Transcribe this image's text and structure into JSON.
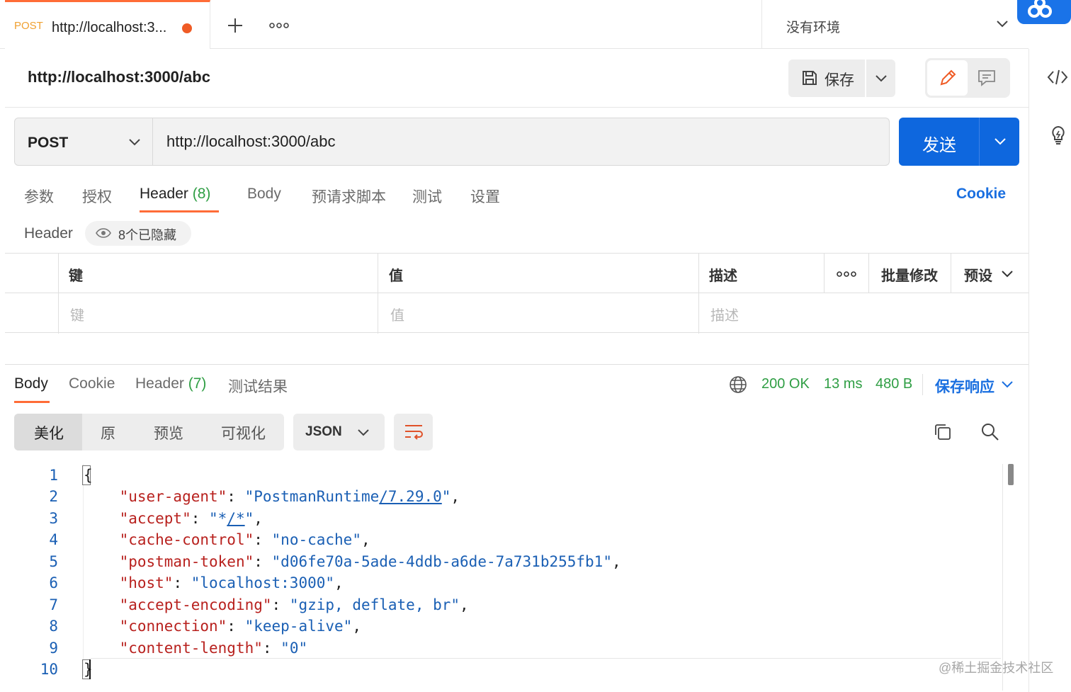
{
  "tabbar": {
    "active_tab": {
      "method": "POST",
      "title": "http://localhost:3..."
    },
    "new_tab_icon": "plus-icon",
    "more_icon": "more-horizontal-icon",
    "environment": "没有环境"
  },
  "request": {
    "title": "http://localhost:3000/abc",
    "save_label": "保存",
    "method": "POST",
    "url": "http://localhost:3000/abc",
    "send_label": "发送"
  },
  "request_tabs": {
    "params": "参数",
    "auth": "授权",
    "headers": "Header",
    "headers_count": "(8)",
    "body": "Body",
    "prerequest": "预请求脚本",
    "tests": "测试",
    "settings": "设置",
    "cookie": "Cookie"
  },
  "headers_section": {
    "title": "Header",
    "hidden_label": "8个已隐藏",
    "table": {
      "col_key": "键",
      "col_value": "值",
      "col_desc": "描述",
      "bulk_edit": "批量修改",
      "presets": "预设",
      "placeholder_key": "键",
      "placeholder_value": "值",
      "placeholder_desc": "描述"
    }
  },
  "response": {
    "tabs": {
      "body": "Body",
      "cookie": "Cookie",
      "headers": "Header",
      "headers_count": "(7)",
      "test_results": "测试结果"
    },
    "status": "200 OK",
    "time": "13 ms",
    "size": "480 B",
    "save_response": "保存响应",
    "views": {
      "pretty": "美化",
      "raw": "原",
      "preview": "预览",
      "visualize": "可视化"
    },
    "format": "JSON"
  },
  "code": {
    "line_numbers": [
      "1",
      "2",
      "3",
      "4",
      "5",
      "6",
      "7",
      "8",
      "9",
      "10"
    ],
    "open_brace": "{",
    "close_brace": "}",
    "lines": [
      {
        "key": "\"user-agent\"",
        "pre": "\"PostmanRuntime",
        "link": "/7.29.0",
        "post": "\"",
        "comma": ","
      },
      {
        "key": "\"accept\"",
        "pre": "\"*",
        "link": "/*",
        "post": "\"",
        "comma": ","
      },
      {
        "key": "\"cache-control\"",
        "pre": "\"no-cache\"",
        "link": "",
        "post": "",
        "comma": ","
      },
      {
        "key": "\"postman-token\"",
        "pre": "\"d06fe70a-5ade-4ddb-a6de-7a731b255fb1\"",
        "link": "",
        "post": "",
        "comma": ","
      },
      {
        "key": "\"host\"",
        "pre": "\"localhost:3000\"",
        "link": "",
        "post": "",
        "comma": ","
      },
      {
        "key": "\"accept-encoding\"",
        "pre": "\"gzip, deflate, br\"",
        "link": "",
        "post": "",
        "comma": ","
      },
      {
        "key": "\"connection\"",
        "pre": "\"keep-alive\"",
        "link": "",
        "post": "",
        "comma": ","
      },
      {
        "key": "\"content-length\"",
        "pre": "\"0\"",
        "link": "",
        "post": "",
        "comma": ""
      }
    ]
  },
  "watermark": "@稀土掘金技术社区",
  "colors": {
    "accent": "#ff6c37",
    "primary": "#0e67de",
    "success": "#2f9e44",
    "json_key": "#b8211e",
    "json_string": "#1a5fb4"
  }
}
